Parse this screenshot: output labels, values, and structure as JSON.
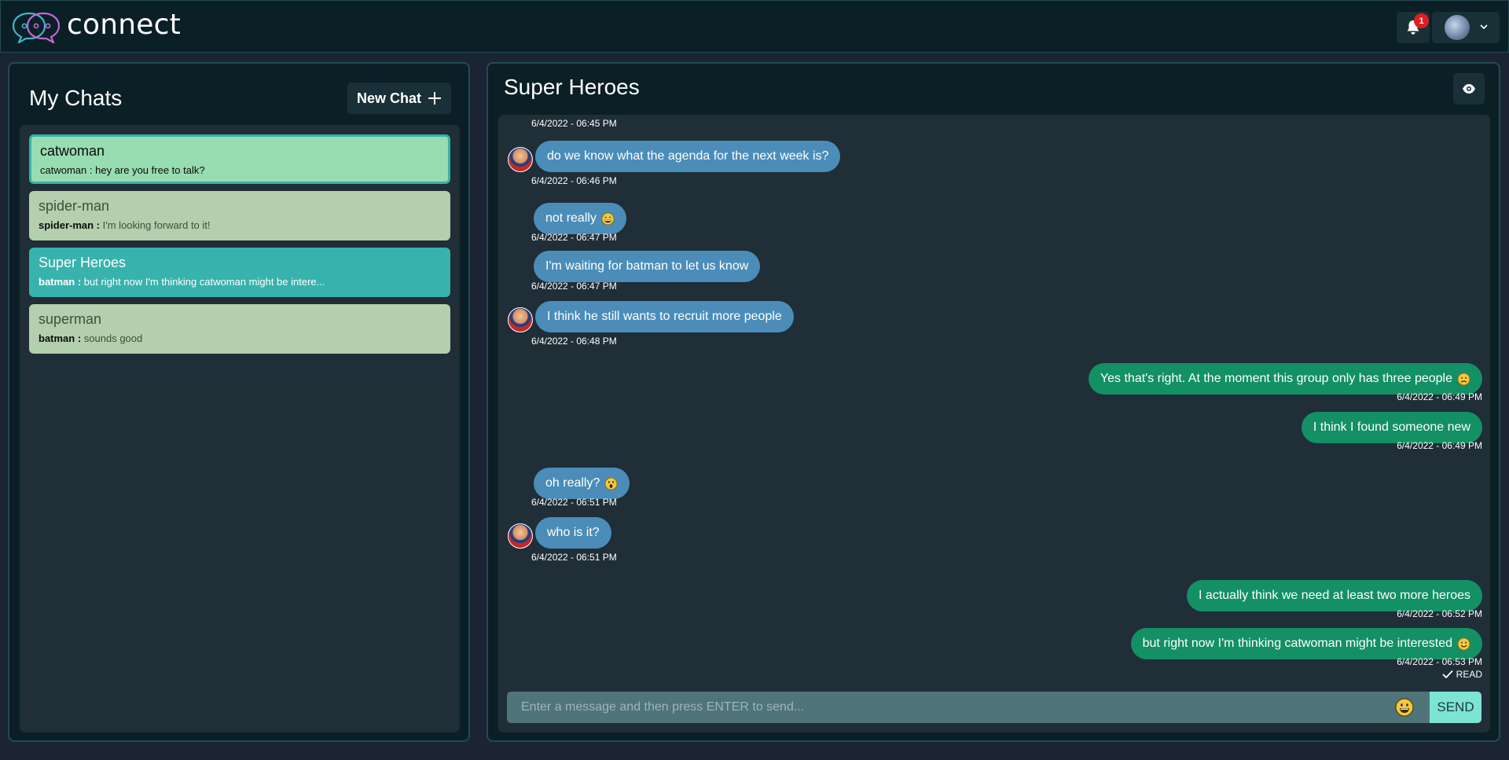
{
  "header": {
    "app_name": "connect",
    "notification_count": "1"
  },
  "sidebar": {
    "title": "My Chats",
    "new_chat_label": "New Chat",
    "chats": [
      {
        "name": "catwoman",
        "sender": "catwoman :",
        "preview": "hey are you free to talk?"
      },
      {
        "name": "spider-man",
        "sender": "spider-man :",
        "preview": "I'm looking forward to it!"
      },
      {
        "name": "Super Heroes",
        "sender": "batman :",
        "preview": "but right now I'm thinking catwoman might be intere..."
      },
      {
        "name": "superman",
        "sender": "batman :",
        "preview": "sounds good"
      }
    ]
  },
  "chat": {
    "title": "Super Heroes",
    "top_timestamp": "6/4/2022 - 06:45 PM",
    "messages": [
      {
        "text": "do we know what the agenda for the next week is?",
        "time": "6/4/2022 - 06:46 PM",
        "direction": "in",
        "emoji": ""
      },
      {
        "text": "not really",
        "time": "6/4/2022 - 06:47 PM",
        "direction": "in",
        "emoji": "grin"
      },
      {
        "text": "I'm waiting for batman to let us know",
        "time": "6/4/2022 - 06:47 PM",
        "direction": "in",
        "emoji": ""
      },
      {
        "text": "I think he still wants to recruit more people",
        "time": "6/4/2022 - 06:48 PM",
        "direction": "in",
        "emoji": ""
      },
      {
        "text": "Yes that's right. At the moment this group only has three people",
        "time": "6/4/2022 - 06:49 PM",
        "direction": "out",
        "emoji": "sad"
      },
      {
        "text": "I think I found someone new",
        "time": "6/4/2022 - 06:49 PM",
        "direction": "out",
        "emoji": ""
      },
      {
        "text": "oh really?",
        "time": "6/4/2022 - 06:51 PM",
        "direction": "in",
        "emoji": "surprised"
      },
      {
        "text": "who is it?",
        "time": "6/4/2022 - 06:51 PM",
        "direction": "in",
        "emoji": ""
      },
      {
        "text": "I actually think we need at least two more heroes",
        "time": "6/4/2022 - 06:52 PM",
        "direction": "out",
        "emoji": ""
      },
      {
        "text": "but right now I'm thinking catwoman might be interested",
        "time": "6/4/2022 - 06:53 PM",
        "direction": "out",
        "emoji": "smile"
      }
    ],
    "read_label": "READ",
    "input_placeholder": "Enter a message and then press ENTER to send...",
    "send_label": "SEND"
  },
  "colors": {
    "incoming_bubble": "#4b8db8",
    "outgoing_bubble": "#139064",
    "active_chat": "#38b2ac",
    "selected_chat": "#98dcb1",
    "send_button": "#7de3d3"
  }
}
